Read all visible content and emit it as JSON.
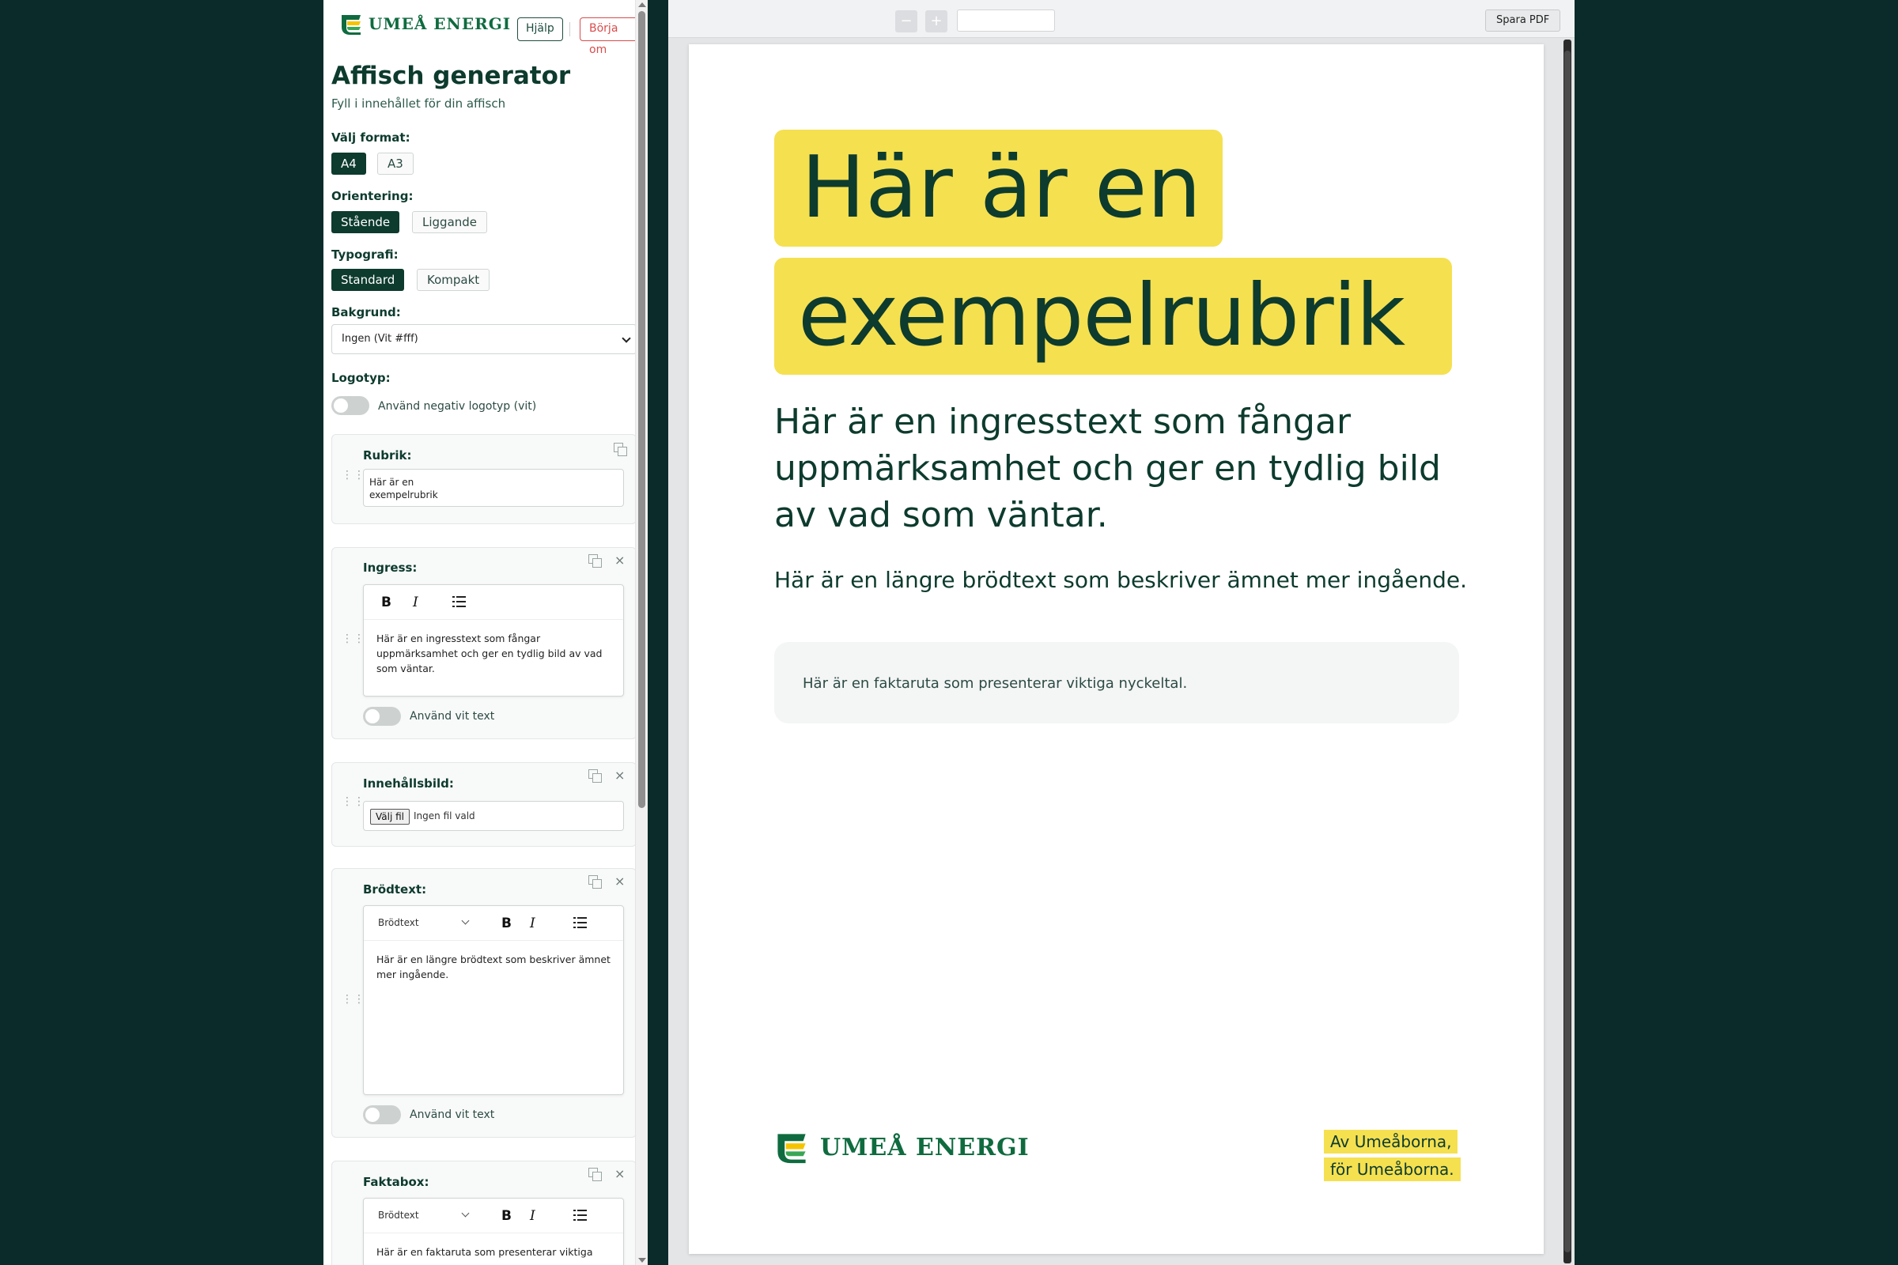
{
  "brand": {
    "name": "UMEÅ ENERGI",
    "green": "#0f6b3f",
    "yellow": "#f5e050",
    "dark": "#0d3b2e"
  },
  "header": {
    "help_label": "Hjälp",
    "reset_label": "Börja om"
  },
  "app": {
    "title": "Affisch generator",
    "subtitle": "Fyll i innehållet för din affisch"
  },
  "format": {
    "label": "Välj format:",
    "options": [
      "A4",
      "A3"
    ],
    "selected": "A4"
  },
  "orientation": {
    "label": "Orientering:",
    "options": [
      "Stående",
      "Liggande"
    ],
    "selected": "Stående"
  },
  "typography": {
    "label": "Typografi:",
    "options": [
      "Standard",
      "Kompakt"
    ],
    "selected": "Standard"
  },
  "background": {
    "label": "Bakgrund:",
    "value": "Ingen (Vit #fff)"
  },
  "logo": {
    "label": "Logotyp:",
    "toggle_label": "Använd negativ logotyp (vit)",
    "toggle_on": false
  },
  "blocks": {
    "rubrik": {
      "label": "Rubrik:",
      "value_line1": "Här är en",
      "value_line2": "exempelrubrik"
    },
    "ingress": {
      "label": "Ingress:",
      "bold": "B",
      "italic": "I",
      "text": "Här är en ingresstext som fångar uppmärksamhet och ger en tydlig bild av vad som väntar.",
      "white_text_label": "Använd vit text"
    },
    "image": {
      "label": "Innehållsbild:",
      "button": "Välj fil",
      "status": "Ingen fil vald"
    },
    "brodtext": {
      "label": "Brödtext:",
      "style": "Brödtext",
      "bold": "B",
      "italic": "I",
      "text": "Här är en längre brödtext som beskriver ämnet mer ingående.",
      "white_text_label": "Använd vit text"
    },
    "faktabox": {
      "label": "Faktabox:",
      "style": "Brödtext",
      "bold": "B",
      "italic": "I",
      "text": "Här är en faktaruta som presenterar viktiga"
    }
  },
  "viewer": {
    "zoom_out": "−",
    "zoom_in": "+",
    "save_pdf": "Spara PDF"
  },
  "poster": {
    "headline_line1": "Här är en",
    "headline_line2": "exempelrubrik",
    "ingress": "Här är en ingresstext som fångar uppmärksamhet och ger en tydlig bild av vad som väntar.",
    "body": "Här är en längre brödtext som beskriver ämnet mer ingående.",
    "fact": "Här är en faktaruta som presenterar viktiga nyckeltal.",
    "logo_text": "UMEÅ ENERGI",
    "slogan_line1": "Av Umeåborna,",
    "slogan_line2": "för Umeåborna."
  }
}
